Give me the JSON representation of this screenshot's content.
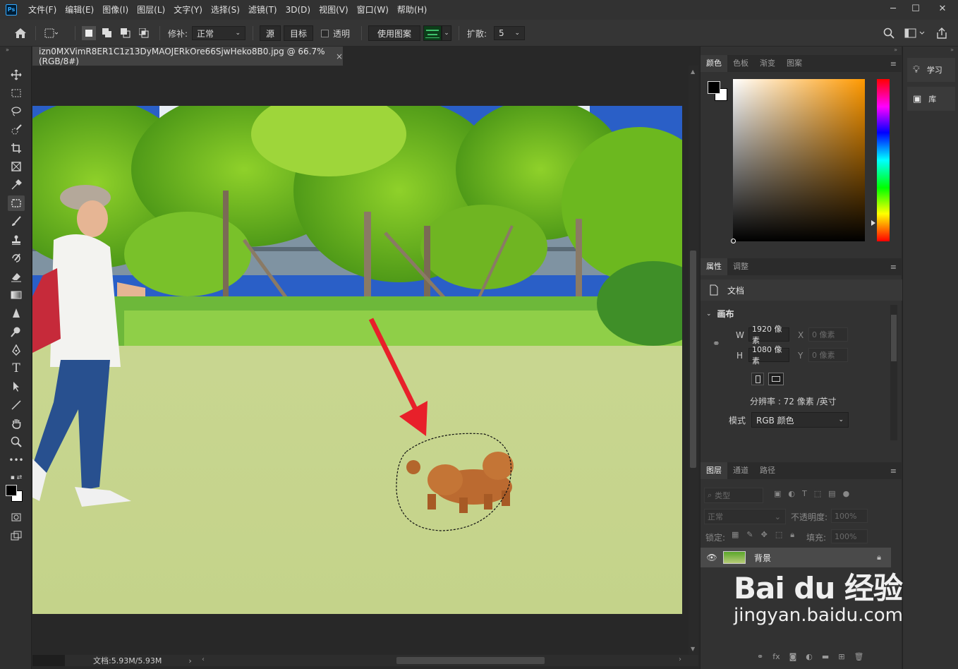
{
  "app": {
    "logo": "Ps"
  },
  "menu": [
    "文件(F)",
    "编辑(E)",
    "图像(I)",
    "图层(L)",
    "文字(Y)",
    "选择(S)",
    "滤镜(T)",
    "3D(D)",
    "视图(V)",
    "窗口(W)",
    "帮助(H)"
  ],
  "options": {
    "patch_label": "修补:",
    "patch_mode": "正常",
    "source_label": "源",
    "target_label": "目标",
    "transparent_label": "透明",
    "use_pattern_label": "使用图案",
    "diffusion_label": "扩散:",
    "diffusion_value": "5"
  },
  "document": {
    "tab_title": "izn0MXVimR8ER1C1z13DyMAOJERkOre66SjwHeko8B0.jpg @ 66.7%(RGB/8#)",
    "status": "文档:5.93M/5.93M"
  },
  "color_panel": {
    "tabs": [
      "颜色",
      "色板",
      "渐变",
      "图案"
    ],
    "active_tab": "颜色",
    "foreground": "#000000",
    "background": "#ffffff"
  },
  "properties_panel": {
    "tabs": [
      "属性",
      "调整"
    ],
    "doc_label": "文档",
    "canvas_section": "画布",
    "w_label": "W",
    "w_value": "1920 像素",
    "h_label": "H",
    "h_value": "1080 像素",
    "x_label": "X",
    "x_value": "0 像素",
    "y_label": "Y",
    "y_value": "0 像素",
    "resolution": "分辨率 : 72 像素 /英寸",
    "mode_label": "模式",
    "mode_value": "RGB 颜色"
  },
  "layers_panel": {
    "tabs": [
      "图层",
      "通道",
      "路径"
    ],
    "filter_placeholder": "类型",
    "blend_mode": "正常",
    "opacity_label": "不透明度:",
    "opacity_value": "100%",
    "lock_label": "锁定:",
    "fill_label": "填充:",
    "fill_value": "100%",
    "layers": [
      {
        "name": "背景"
      }
    ]
  },
  "dock": {
    "learn": "学习",
    "library": "库"
  },
  "watermark": {
    "brand": "Bai du 经验",
    "url": "jingyan.baidu.com"
  },
  "colors": {
    "accent": "#31a8ff",
    "arrow": "#e8202a"
  }
}
